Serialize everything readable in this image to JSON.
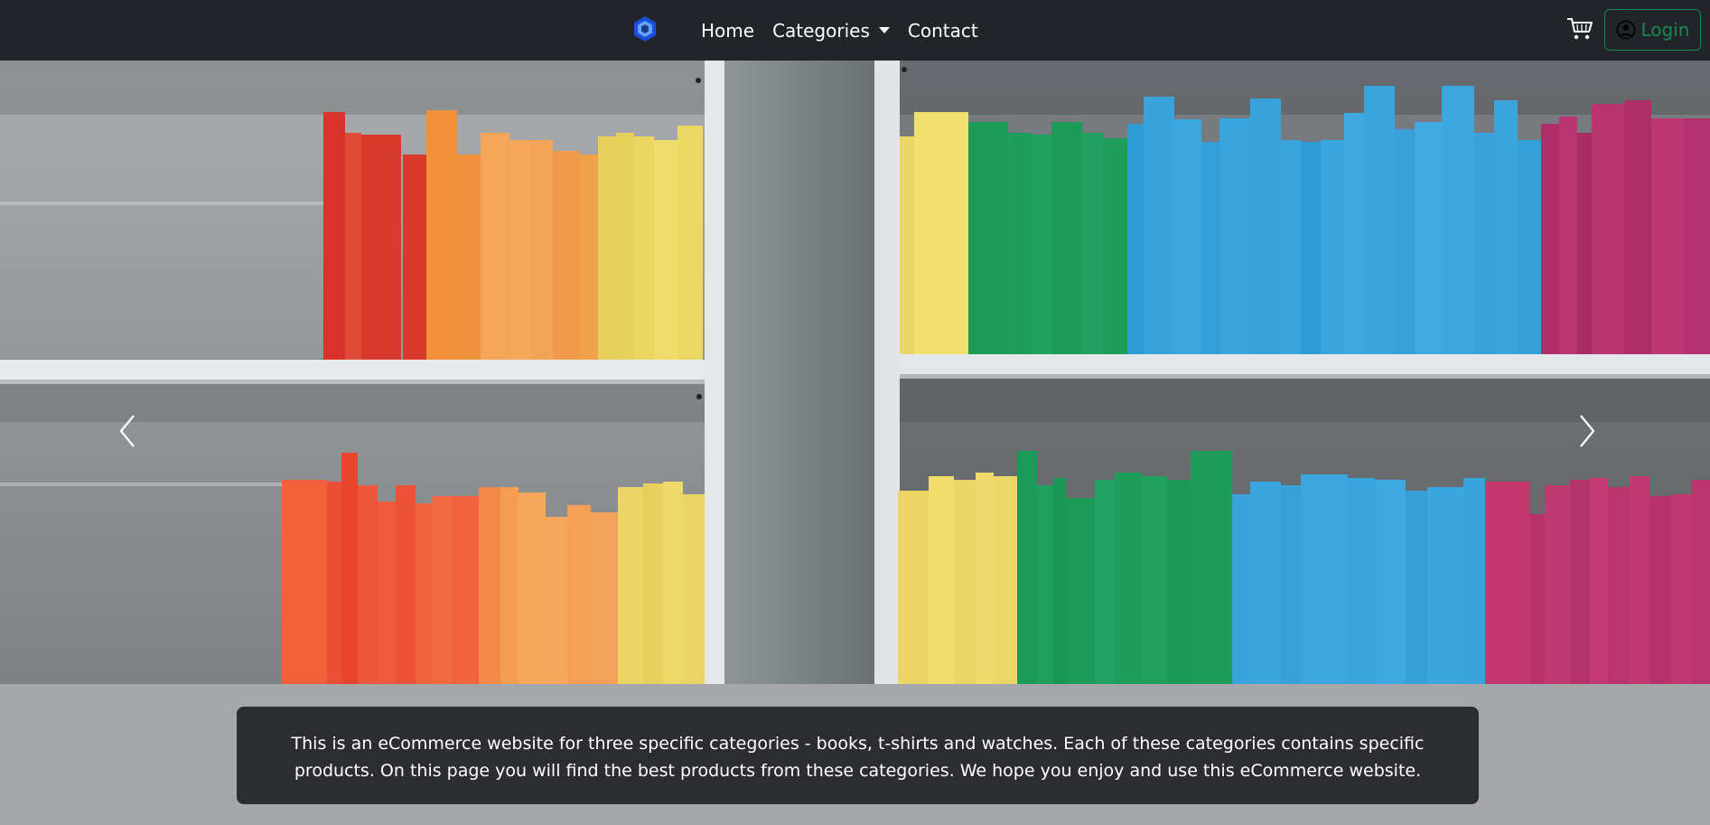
{
  "navbar": {
    "logo_icon": "hexagon-logo-icon",
    "links": [
      {
        "label": "Home"
      },
      {
        "label": "Categories"
      },
      {
        "label": "Contact"
      }
    ],
    "cart_icon": "cart-icon",
    "login_label": "Login",
    "login_icon": "user-circle-icon"
  },
  "carousel": {
    "prev_icon": "chevron-left-icon",
    "next_icon": "chevron-right-icon"
  },
  "description": {
    "text": "This is an eCommerce website for three specific categories - books, t-shirts and watches. Each of these categories contains specific products. On this page you will find the best products from these categories. We hope you enjoy and use this eCommerce website."
  },
  "colors": {
    "navbar_bg": "#212529",
    "login_accent": "#198754",
    "page_bg": "#a6a7aa",
    "description_bg": "#2b2d30"
  }
}
